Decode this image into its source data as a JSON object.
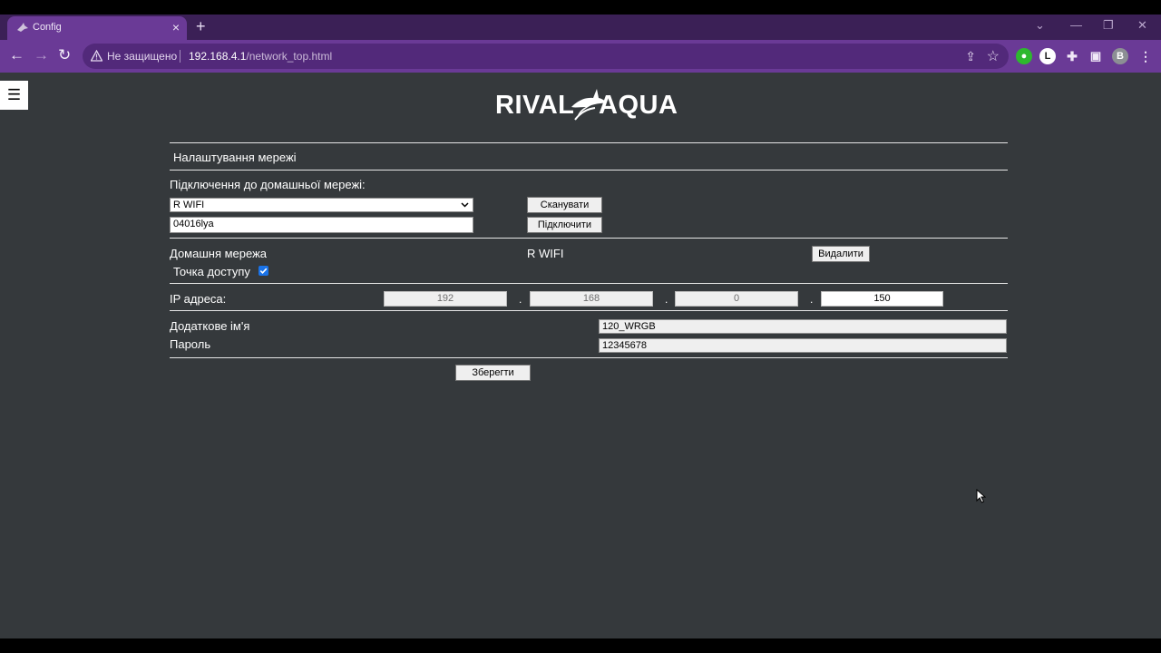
{
  "browser": {
    "tab_title": "Config",
    "tab_close": "×",
    "new_tab": "+",
    "security_label": "Не защищено",
    "url_host": "192.168.4.1",
    "url_path": "/network_top.html",
    "profile_initial": "B",
    "extension_initial": "L",
    "accent_color": "#6a3a96"
  },
  "header": {
    "menu_icon": "☰",
    "logo_left": "RIVAL",
    "logo_right": "AQUA"
  },
  "section": {
    "title": "Налаштування мережі"
  },
  "home_network": {
    "label": "Підключення до домашньої мережі:",
    "selected_network": "R WIFI",
    "password_value": "04016lya",
    "scan_button": "Сканувати",
    "connect_button": "Підключити"
  },
  "status": {
    "home_label": "Домашня мережа",
    "home_value": "R WIFI",
    "delete_button": "Видалити",
    "access_point_label": "Точка доступу",
    "access_point_checked": true
  },
  "ip": {
    "label": "IP адреса:",
    "octets": [
      "192",
      "168",
      "0",
      "150"
    ],
    "separator": "."
  },
  "extra": {
    "name_label": "Додаткове ім'я",
    "name_value": "120_WRGB",
    "password_label": "Пароль",
    "password_value": "12345678"
  },
  "save_button": "Зберегти"
}
